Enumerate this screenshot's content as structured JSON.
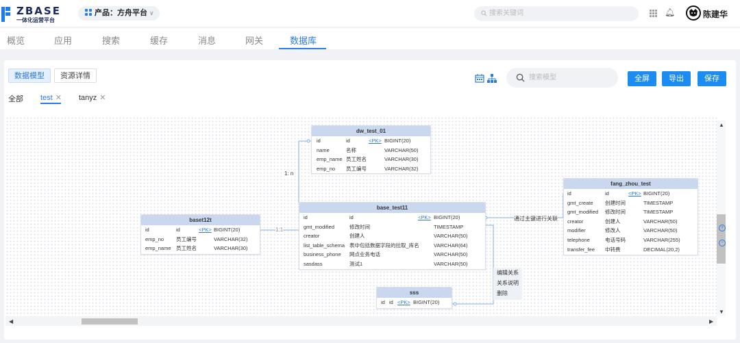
{
  "header": {
    "logo_title": "ZBASE",
    "logo_subtitle": "一体化运营平台",
    "product_label": "产品：方舟平台",
    "search_placeholder": "搜索关键词",
    "user_name": "陈建华"
  },
  "nav": {
    "tabs": [
      "概览",
      "应用",
      "搜索",
      "缓存",
      "消息",
      "网关",
      "数据库"
    ],
    "active": "数据库"
  },
  "toolbar": {
    "view_tabs": [
      "数据模型",
      "资源详情"
    ],
    "search_placeholder": "搜索模型",
    "actions": [
      "全屏",
      "导出",
      "保存"
    ]
  },
  "filter_tabs": [
    {
      "label": "全部",
      "closable": false
    },
    {
      "label": "test",
      "closable": true,
      "active": true
    },
    {
      "label": "tanyz",
      "closable": true
    }
  ],
  "tables": {
    "dw_test_01": {
      "name": "dw_test_01",
      "rows": [
        [
          "id",
          "id",
          "<PK>",
          "BIGINT(20)"
        ],
        [
          "name",
          "名称",
          "",
          "VARCHAR(50)"
        ],
        [
          "emp_name",
          "员工姓名",
          "",
          "VARCHAR(30)"
        ],
        [
          "emp_no",
          "员工编号",
          "",
          "VARCHAR(32)"
        ]
      ]
    },
    "baset12t": {
      "name": "baset12t",
      "rows": [
        [
          "id",
          "id",
          "<PK>",
          "BIGINT(20)"
        ],
        [
          "emp_no",
          "员工编号",
          "",
          "VARCHAR(32)"
        ],
        [
          "emp_name",
          "员工姓名",
          "",
          "VARCHAR(30)"
        ]
      ]
    },
    "base_test11": {
      "name": "base_test11",
      "rows": [
        [
          "id",
          "id",
          "<PK>",
          "BIGINT(20)"
        ],
        [
          "gmt_modified",
          "修改时间",
          "",
          "TIMESTAMP"
        ],
        [
          "creator",
          "创建人",
          "",
          "VARCHAR(50)"
        ],
        [
          "list_table_schema",
          "表中包括数据字段的拉取_库名",
          "",
          "VARCHAR(64)"
        ],
        [
          "business_phone",
          "网点业务电话",
          "",
          "VARCHAR(50)"
        ],
        [
          "sasdass",
          "测试1",
          "",
          "VARCHAR(50)"
        ]
      ]
    },
    "fang_zhou_test": {
      "name": "fang_zhou_test",
      "rows": [
        [
          "id",
          "id",
          "<PK>",
          "BIGINT(20)"
        ],
        [
          "gmt_create",
          "创建时间",
          "",
          "TIMESTAMP"
        ],
        [
          "gmt_modified",
          "修改时间",
          "",
          "TIMESTAMP"
        ],
        [
          "creator",
          "创建人",
          "",
          "VARCHAR(50)"
        ],
        [
          "modifier",
          "修改人",
          "",
          "VARCHAR(50)"
        ],
        [
          "telephone",
          "电话号码",
          "",
          "VARCHAR(255)"
        ],
        [
          "transfer_fee",
          "中转费",
          "",
          "DECIMAL(20,2)"
        ]
      ]
    },
    "sss": {
      "name": "sss",
      "rows": [
        [
          "id",
          "id",
          "<PK>",
          "BIGINT(20)"
        ]
      ]
    }
  },
  "relations": {
    "r1": "1: n",
    "r2": "1:1",
    "r3": "通过主键进行关联"
  },
  "context_menu": [
    "编辑关系",
    "关系说明",
    "删除"
  ]
}
